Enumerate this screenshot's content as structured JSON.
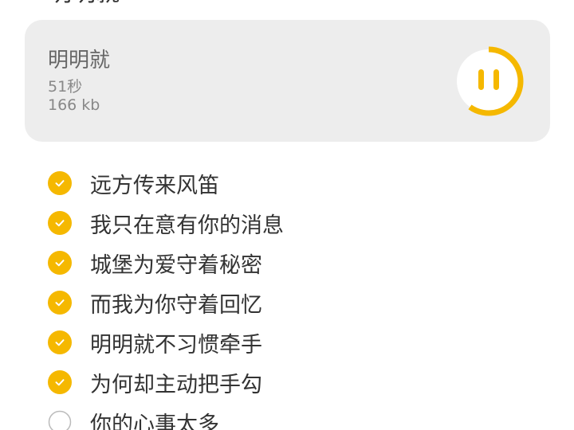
{
  "header": {
    "title": "明明就"
  },
  "audio": {
    "name": "明明就",
    "duration": "51秒",
    "size": "166 kb",
    "state": "playing",
    "progress": 0.6,
    "control_icon": "pause-icon",
    "accent_color": "#F5B800"
  },
  "checklist": {
    "items": [
      {
        "label": "远方传来风笛",
        "checked": true
      },
      {
        "label": "我只在意有你的消息",
        "checked": true
      },
      {
        "label": "城堡为爱守着秘密",
        "checked": true
      },
      {
        "label": "而我为你守着回忆",
        "checked": true
      },
      {
        "label": "明明就不习惯牵手",
        "checked": true
      },
      {
        "label": "为何却主动把手勾",
        "checked": true
      },
      {
        "label": "你的心事太多",
        "checked": false
      }
    ],
    "checked_color": "#F5B800",
    "unchecked_color": "#BBBBBB"
  }
}
